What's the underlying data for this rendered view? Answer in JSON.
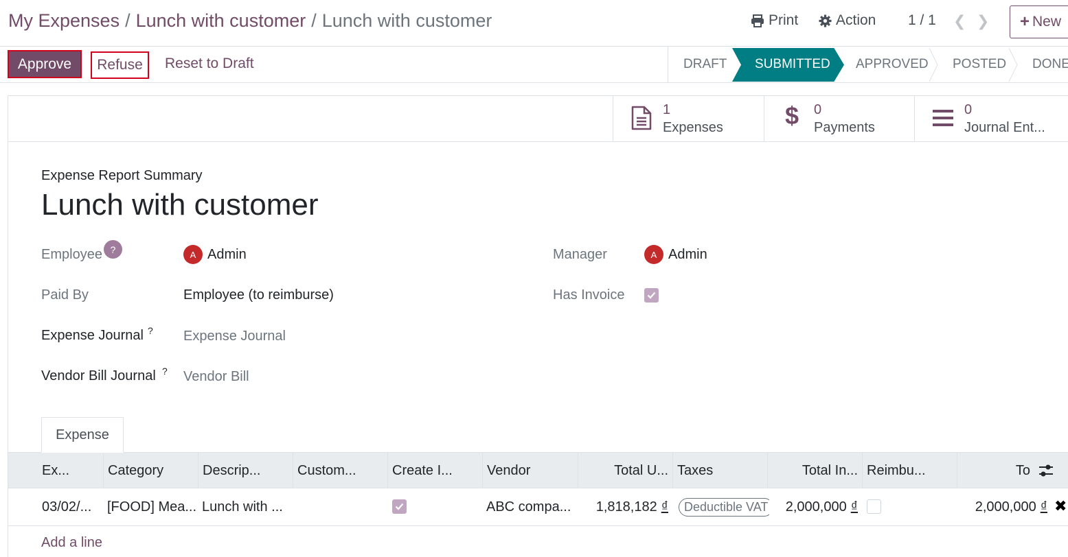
{
  "breadcrumb": {
    "items": [
      "My Expenses",
      "Lunch with customer"
    ],
    "current": "Lunch with customer",
    "separator": "/"
  },
  "toolbar": {
    "print_label": "Print",
    "action_label": "Action",
    "pager": "1 / 1",
    "new_label": "New"
  },
  "statusbar": {
    "approve_label": "Approve",
    "refuse_label": "Refuse",
    "reset_label": "Reset to Draft",
    "stages": [
      "DRAFT",
      "SUBMITTED",
      "APPROVED",
      "POSTED",
      "DONE"
    ],
    "active_stage": "SUBMITTED"
  },
  "smart_buttons": [
    {
      "count": "1",
      "label": "Expenses",
      "icon": "document-icon"
    },
    {
      "count": "0",
      "label": "Payments",
      "icon": "dollar-icon"
    },
    {
      "count": "0",
      "label": "Journal Ent...",
      "icon": "list-icon"
    }
  ],
  "form": {
    "summary_label": "Expense Report Summary",
    "title": "Lunch with customer",
    "help_mark": "?",
    "sup_mark": "?",
    "employee_label": "Employee",
    "employee_value": "Admin",
    "employee_avatar": "A",
    "manager_label": "Manager",
    "manager_value": "Admin",
    "manager_avatar": "A",
    "paid_by_label": "Paid By",
    "paid_by_value": "Employee (to reimburse)",
    "has_invoice_label": "Has Invoice",
    "has_invoice": true,
    "expense_journal_label": "Expense Journal",
    "expense_journal_value": "Expense Journal",
    "vendor_bill_journal_label": "Vendor Bill Journal",
    "vendor_bill_journal_value": "Vendor Bill"
  },
  "tabs": {
    "expense": "Expense"
  },
  "table": {
    "headers": [
      "Ex...",
      "Category",
      "Descrip...",
      "Custom...",
      "Create I...",
      "Vendor",
      "Total U...",
      "Taxes",
      "Total In...",
      "Reimbu...",
      "To"
    ],
    "row": {
      "date": "03/02/...",
      "category": "[FOOD] Mea...",
      "description": "Lunch with ...",
      "customer": "",
      "create_invoice": true,
      "vendor": "ABC compa...",
      "total_untaxed": "1,818,182",
      "currency": "₫",
      "taxes": "Deductible VAT",
      "total_incl": "2,000,000",
      "reimbursed": false,
      "total": "2,000,000"
    },
    "add_line": "Add a line"
  },
  "colors": {
    "primary": "#714b67",
    "stage_active": "#017e84",
    "highlight_border": "#d0021b",
    "avatar": "#c52a2a"
  }
}
